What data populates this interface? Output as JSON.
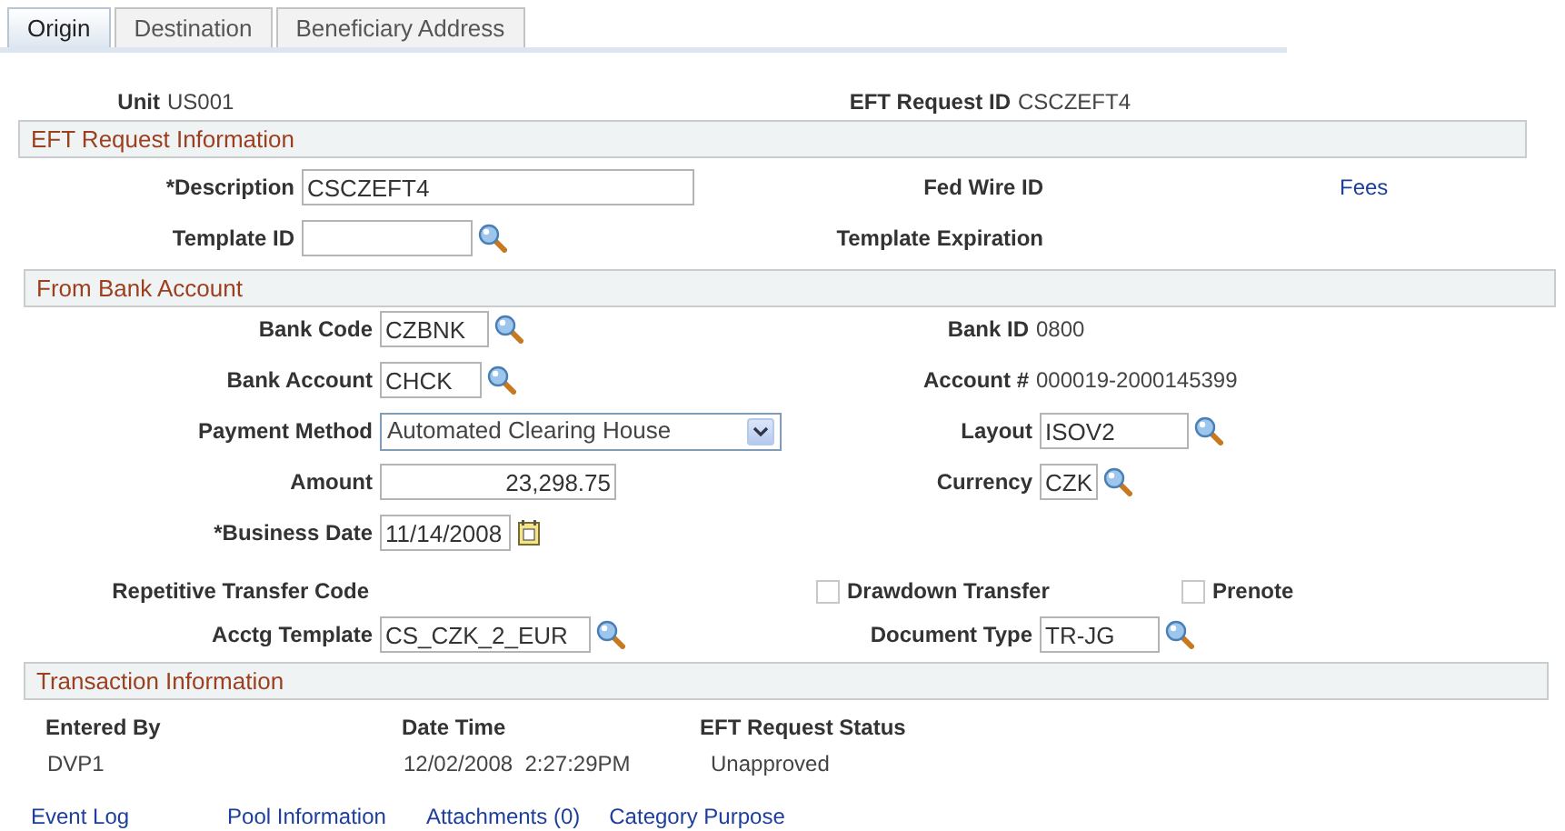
{
  "tabs": [
    {
      "label": "Origin",
      "selected": true
    },
    {
      "label": "Destination",
      "selected": false
    },
    {
      "label": "Beneficiary Address",
      "selected": false
    }
  ],
  "unit": {
    "label": "Unit",
    "value": "US001"
  },
  "eft_request_id": {
    "label": "EFT Request ID",
    "value": "CSCZEFT4"
  },
  "eft_request_information": {
    "title": "EFT Request Information",
    "description": {
      "label": "*Description",
      "value": "CSCZEFT4"
    },
    "fed_wire_id": {
      "label": "Fed Wire ID"
    },
    "fees_link": "Fees",
    "template_id": {
      "label": "Template ID"
    },
    "template_expiration": {
      "label": "Template Expiration"
    }
  },
  "from_bank_account": {
    "title": "From Bank Account",
    "bank_code": {
      "label": "Bank Code",
      "value": "CZBNK"
    },
    "bank_id": {
      "label": "Bank ID",
      "value": "0800"
    },
    "bank_account": {
      "label": "Bank Account",
      "value": "CHCK"
    },
    "account_number": {
      "label": "Account #",
      "value": "000019-2000145399"
    },
    "payment_method": {
      "label": "Payment Method",
      "value": "Automated Clearing House"
    },
    "layout": {
      "label": "Layout",
      "value": "ISOV2"
    },
    "amount": {
      "label": "Amount",
      "value": "23,298.75"
    },
    "currency": {
      "label": "Currency",
      "value": "CZK"
    },
    "business_date": {
      "label": "*Business Date",
      "value": "11/14/2008"
    },
    "repetitive_transfer_code": {
      "label": "Repetitive Transfer Code"
    },
    "drawdown_transfer": {
      "label": "Drawdown Transfer",
      "checked": false
    },
    "prenote": {
      "label": "Prenote",
      "checked": false
    },
    "acctg_template": {
      "label": "Acctg Template",
      "value": "CS_CZK_2_EUR"
    },
    "document_type": {
      "label": "Document Type",
      "value": "TR-JG"
    }
  },
  "transaction_information": {
    "title": "Transaction Information",
    "columns": [
      "Entered By",
      "Date Time",
      "EFT Request Status"
    ],
    "values": [
      "DVP1",
      "12/02/2008  2:27:29PM",
      "Unapproved"
    ]
  },
  "links": [
    "Event Log",
    "Pool Information",
    "Attachments (0)",
    "Category Purpose"
  ]
}
